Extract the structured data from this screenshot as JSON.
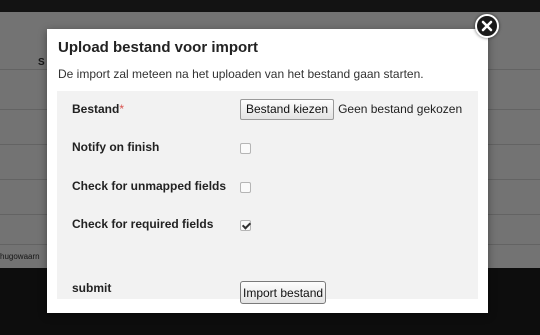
{
  "background": {
    "header_fragment": "S",
    "side_fragment": "hugowaarn"
  },
  "modal": {
    "title": "Upload bestand voor import",
    "description": "De import zal meteen na het uploaden van het bestand gaan starten.",
    "close_icon": "close-icon"
  },
  "form": {
    "file": {
      "label": "Bestand",
      "required_marker": "*",
      "button_label": "Bestand kiezen",
      "status": "Geen bestand gekozen"
    },
    "notify_on_finish": {
      "label": "Notify on finish",
      "checked": false
    },
    "check_unmapped": {
      "label": "Check for unmapped fields",
      "checked": false
    },
    "check_required": {
      "label": "Check for required fields",
      "checked": true
    },
    "submit": {
      "label": "submit",
      "button_label": "Import bestand"
    }
  }
}
